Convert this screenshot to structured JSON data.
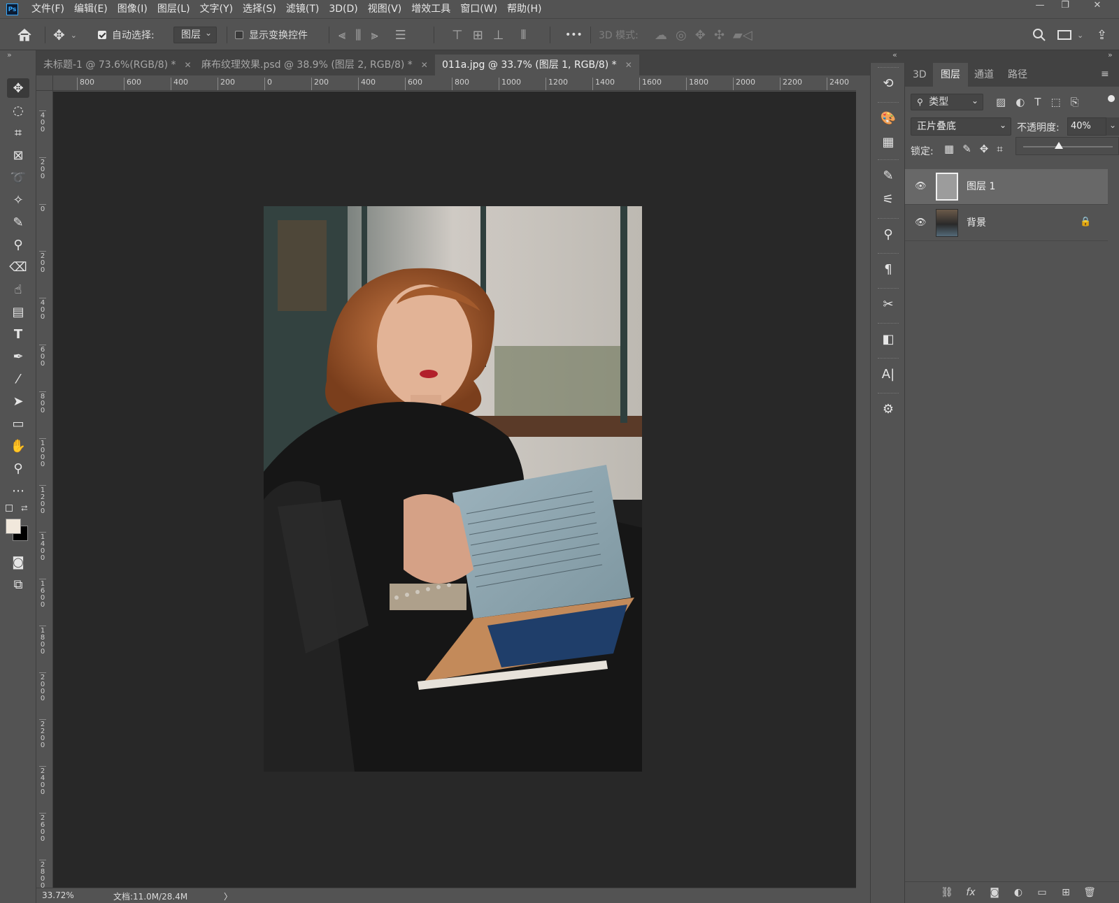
{
  "app": {
    "logo_text": "Ps"
  },
  "menu": {
    "items": [
      "文件(F)",
      "编辑(E)",
      "图像(I)",
      "图层(L)",
      "文字(Y)",
      "选择(S)",
      "滤镜(T)",
      "3D(D)",
      "视图(V)",
      "增效工具",
      "窗口(W)",
      "帮助(H)"
    ]
  },
  "window_controls": {
    "minimize": "—",
    "restore": "❐",
    "close": "✕"
  },
  "options": {
    "auto_select_label": "自动选择:",
    "auto_select_checked": true,
    "auto_select_target": "图层",
    "show_transform_label": "显示变换控件",
    "show_transform_checked": false,
    "mode_3d_label": "3D 模式:",
    "more_label": "•••"
  },
  "tabs": [
    {
      "label": "未标题-1 @ 73.6%(RGB/8) *",
      "active": false
    },
    {
      "label": "麻布纹理效果.psd @ 38.9% (图层 2, RGB/8) *",
      "active": false
    },
    {
      "label": "011a.jpg @ 33.7% (图层 1, RGB/8) *",
      "active": true
    }
  ],
  "ruler": {
    "horizontal": [
      "800",
      "600",
      "400",
      "200",
      "0",
      "200",
      "400",
      "600",
      "800",
      "1000",
      "1200",
      "1400",
      "1600",
      "1800",
      "2000",
      "2200",
      "2400"
    ],
    "vertical": [
      "4 0 0",
      "2 0 0",
      "0",
      "2 0 0",
      "4 0 0",
      "6 0 0",
      "8 0 0",
      "1 0 0 0",
      "1 2 0 0",
      "1 4 0 0",
      "1 6 0 0",
      "1 8 0 0",
      "2 0 0 0",
      "2 2 0 0",
      "2 4 0 0",
      "2 6 0 0",
      "2 8 0 0"
    ]
  },
  "status": {
    "zoom": "33.72%",
    "doc": "文档:11.0M/28.4M",
    "arrow": "〉"
  },
  "panel": {
    "tabs": [
      "3D",
      "图层",
      "通道",
      "路径"
    ],
    "active_tab": "图层",
    "filter_kind": "类型",
    "blend_mode": "正片叠底",
    "opacity_label": "不透明度:",
    "opacity_value": "40%",
    "opacity_fraction": 0.4,
    "lock_label": "锁定:",
    "layers": [
      {
        "name": "图层 1",
        "visible": true,
        "selected": true,
        "locked": false
      },
      {
        "name": "背景",
        "visible": true,
        "selected": false,
        "locked": true
      }
    ]
  },
  "colors": {
    "ui_bg": "#535353",
    "canvas_bg": "#282828",
    "accent": "#31a8ff",
    "foreground_swatch": "#f1e8dc",
    "background_swatch": "#000000"
  }
}
